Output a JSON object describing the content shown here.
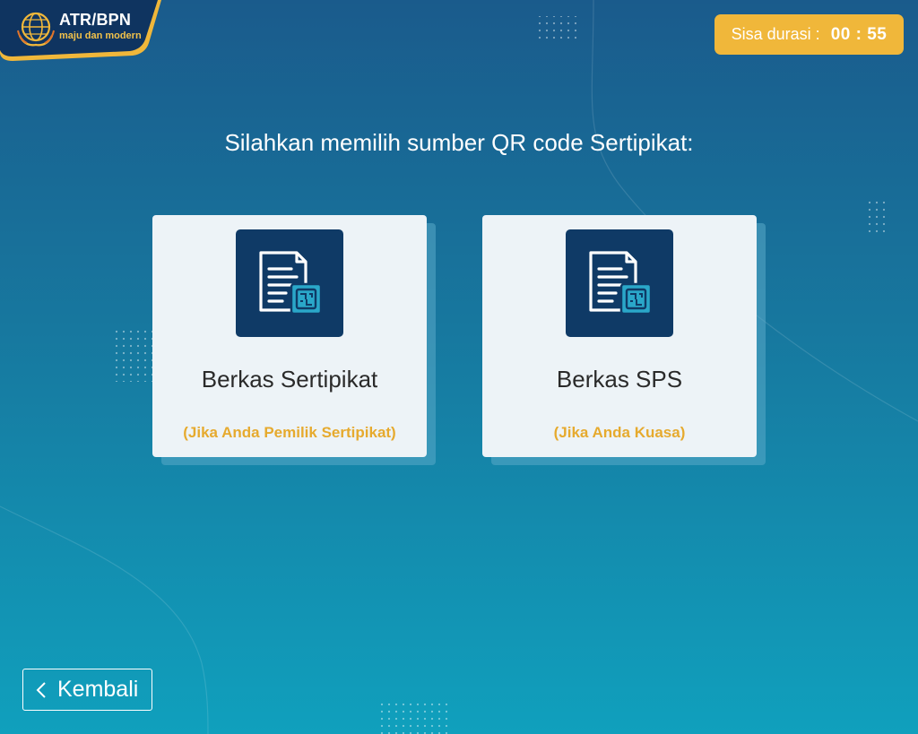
{
  "header": {
    "logo_title": "ATR/BPN",
    "logo_tagline": "maju dan modern",
    "logo_icon": "globe-emblem-icon"
  },
  "timer": {
    "label": "Sisa durasi :",
    "value": "00 : 55"
  },
  "main": {
    "heading": "Silahkan memilih sumber QR code Sertipikat:",
    "options": [
      {
        "title": "Berkas Sertipikat",
        "subtitle": "(Jika Anda Pemilik Sertipikat)",
        "icon": "document-qr-icon"
      },
      {
        "title": "Berkas SPS",
        "subtitle": "(Jika Anda Kuasa)",
        "icon": "document-qr-icon"
      }
    ]
  },
  "footer": {
    "back_label": "Kembali",
    "back_icon": "chevron-left-icon"
  },
  "colors": {
    "background_top": "#1a5b8c",
    "background_bottom": "#10a0bd",
    "accent": "#f0b73a",
    "card_background": "#edf3f7",
    "icon_tile": "#0f3a66",
    "icon_accent": "#2aa7c9",
    "subtitle": "#e6aa2e"
  }
}
